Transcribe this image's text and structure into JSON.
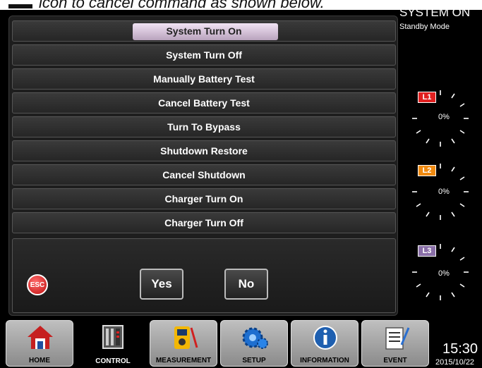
{
  "header": {
    "caption": "icon to cancel command as shown below."
  },
  "commands": [
    {
      "label": "System Turn On",
      "selected": true
    },
    {
      "label": "System Turn Off"
    },
    {
      "label": "Manually Battery Test"
    },
    {
      "label": "Cancel Battery Test"
    },
    {
      "label": "Turn To Bypass"
    },
    {
      "label": "Shutdown Restore"
    },
    {
      "label": "Cancel Shutdown"
    },
    {
      "label": "Charger Turn On"
    },
    {
      "label": "Charger Turn Off"
    }
  ],
  "confirm": {
    "esc_label": "ESC",
    "yes_label": "Yes",
    "no_label": "No"
  },
  "status": {
    "title": "SYSTEM ON",
    "mode": "Standby Mode"
  },
  "gauges": [
    {
      "tag": "L1",
      "value": "0%",
      "color": "#e02020"
    },
    {
      "tag": "L2",
      "value": "0%",
      "color": "#f08a10"
    },
    {
      "tag": "L3",
      "value": "0%",
      "color": "#8a6fa8"
    }
  ],
  "nav": {
    "home": "HOME",
    "control": "CONTROL",
    "measurement": "MEASUREMENT",
    "setup": "SETUP",
    "information": "INFORMATION",
    "event": "EVENT"
  },
  "clock": {
    "time": "15:30",
    "date": "2015/10/22"
  }
}
